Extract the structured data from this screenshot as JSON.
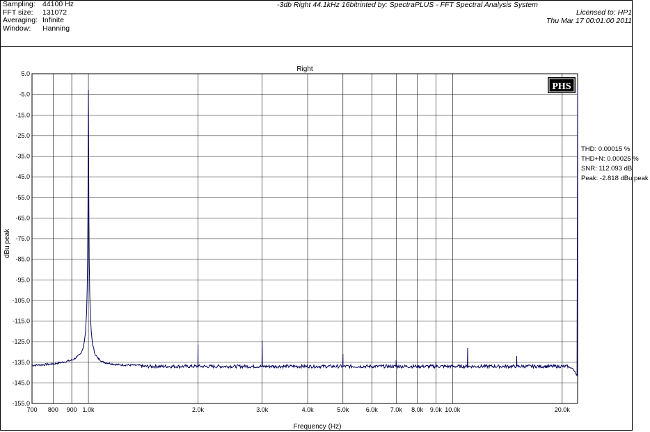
{
  "header": {
    "meta": [
      {
        "label": "Sampling:",
        "value": "44100 Hz"
      },
      {
        "label": "FFT size:",
        "value": "131072"
      },
      {
        "label": "Averaging:",
        "value": "Infinite"
      },
      {
        "label": "Window:",
        "value": "Hanning"
      }
    ],
    "app_title": "-3db Right 44.1kHz 16bitrinted by: SpectraPLUS - FFT Spectral Analysis System",
    "license": "Licensed to: HP1",
    "date": "Thu Mar 17 00:01:00 2011"
  },
  "logo_text": "PHS",
  "stats": [
    "THD: 0.00015 %",
    "THD+N: 0.00025 %",
    "SNR: 112.093 dB",
    "Peak: -2.818 dBu peak"
  ],
  "colors": {
    "trace": "#00005a",
    "grid": "#000000",
    "background": "#ffffff"
  },
  "chart_data": {
    "type": "line",
    "title": "Right",
    "xlabel": "Frequency (Hz)",
    "ylabel": "dBu peak",
    "x_scale": "log",
    "xlim": [
      700,
      22050
    ],
    "ylim": [
      -155,
      5
    ],
    "grid": true,
    "x_ticks": [
      {
        "value": 700,
        "label": "700"
      },
      {
        "value": 800,
        "label": "800"
      },
      {
        "value": 900,
        "label": "900"
      },
      {
        "value": 1000,
        "label": "1.0k"
      },
      {
        "value": 2000,
        "label": "2.0k"
      },
      {
        "value": 3000,
        "label": "3.0k"
      },
      {
        "value": 4000,
        "label": "4.0k"
      },
      {
        "value": 5000,
        "label": "5.0k"
      },
      {
        "value": 6000,
        "label": "6.0k"
      },
      {
        "value": 7000,
        "label": "7.0k"
      },
      {
        "value": 8000,
        "label": "8.0k"
      },
      {
        "value": 9000,
        "label": "9.0k"
      },
      {
        "value": 10000,
        "label": "10.0k"
      },
      {
        "value": 20000,
        "label": "20.0k"
      }
    ],
    "y_ticks": [
      {
        "value": 5,
        "label": "5.0"
      },
      {
        "value": -5,
        "label": "-5.0"
      },
      {
        "value": -15,
        "label": "-15.0"
      },
      {
        "value": -25,
        "label": "-25.0"
      },
      {
        "value": -35,
        "label": "-35.0"
      },
      {
        "value": -45,
        "label": "-45.0"
      },
      {
        "value": -55,
        "label": "-55.0"
      },
      {
        "value": -65,
        "label": "-65.0"
      },
      {
        "value": -75,
        "label": "-75.0"
      },
      {
        "value": -85,
        "label": "-85.0"
      },
      {
        "value": -95,
        "label": "-95.0"
      },
      {
        "value": -105,
        "label": "-105.0"
      },
      {
        "value": -115,
        "label": "-115.0"
      },
      {
        "value": -125,
        "label": "-125.0"
      },
      {
        "value": -135,
        "label": "-135.0"
      },
      {
        "value": -145,
        "label": "-145.0"
      },
      {
        "value": -155,
        "label": "-155.0"
      }
    ],
    "series": [
      {
        "noise_floor_dBu": -137,
        "fundamental": {
          "x": 1000,
          "y": -2.8
        },
        "skirt": [
          {
            "x": 700,
            "y": -136.5
          },
          {
            "x": 750,
            "y": -136.2
          },
          {
            "x": 800,
            "y": -135.8
          },
          {
            "x": 850,
            "y": -135.0
          },
          {
            "x": 900,
            "y": -134.0
          },
          {
            "x": 930,
            "y": -132.5
          },
          {
            "x": 950,
            "y": -131.0
          },
          {
            "x": 965,
            "y": -128.5
          },
          {
            "x": 975,
            "y": -125.0
          },
          {
            "x": 982,
            "y": -120.0
          },
          {
            "x": 988,
            "y": -112.0
          },
          {
            "x": 992,
            "y": -100.0
          },
          {
            "x": 995,
            "y": -85.0
          },
          {
            "x": 997,
            "y": -60.0
          },
          {
            "x": 998.5,
            "y": -30.0
          },
          {
            "x": 1000,
            "y": -2.8
          },
          {
            "x": 1001.5,
            "y": -30.0
          },
          {
            "x": 1003,
            "y": -60.0
          },
          {
            "x": 1005,
            "y": -85.0
          },
          {
            "x": 1008,
            "y": -100.0
          },
          {
            "x": 1012,
            "y": -112.0
          },
          {
            "x": 1018,
            "y": -120.0
          },
          {
            "x": 1026,
            "y": -126.0
          },
          {
            "x": 1040,
            "y": -130.5
          },
          {
            "x": 1060,
            "y": -133.0
          },
          {
            "x": 1100,
            "y": -135.0
          },
          {
            "x": 1200,
            "y": -136.2
          },
          {
            "x": 1400,
            "y": -136.6
          }
        ],
        "harmonics": [
          {
            "x": 2000,
            "y": -126.5
          },
          {
            "x": 3000,
            "y": -124.5
          },
          {
            "x": 5000,
            "y": -131.0
          },
          {
            "x": 7000,
            "y": -134.0
          },
          {
            "x": 9000,
            "y": -135.0
          },
          {
            "x": 11000,
            "y": -128.0
          },
          {
            "x": 15000,
            "y": -132.0
          }
        ],
        "rolloff": [
          {
            "x": 20800,
            "y": -137.2
          },
          {
            "x": 21300,
            "y": -138.0
          },
          {
            "x": 21700,
            "y": -139.5
          },
          {
            "x": 22050,
            "y": -142.5
          }
        ]
      }
    ]
  }
}
